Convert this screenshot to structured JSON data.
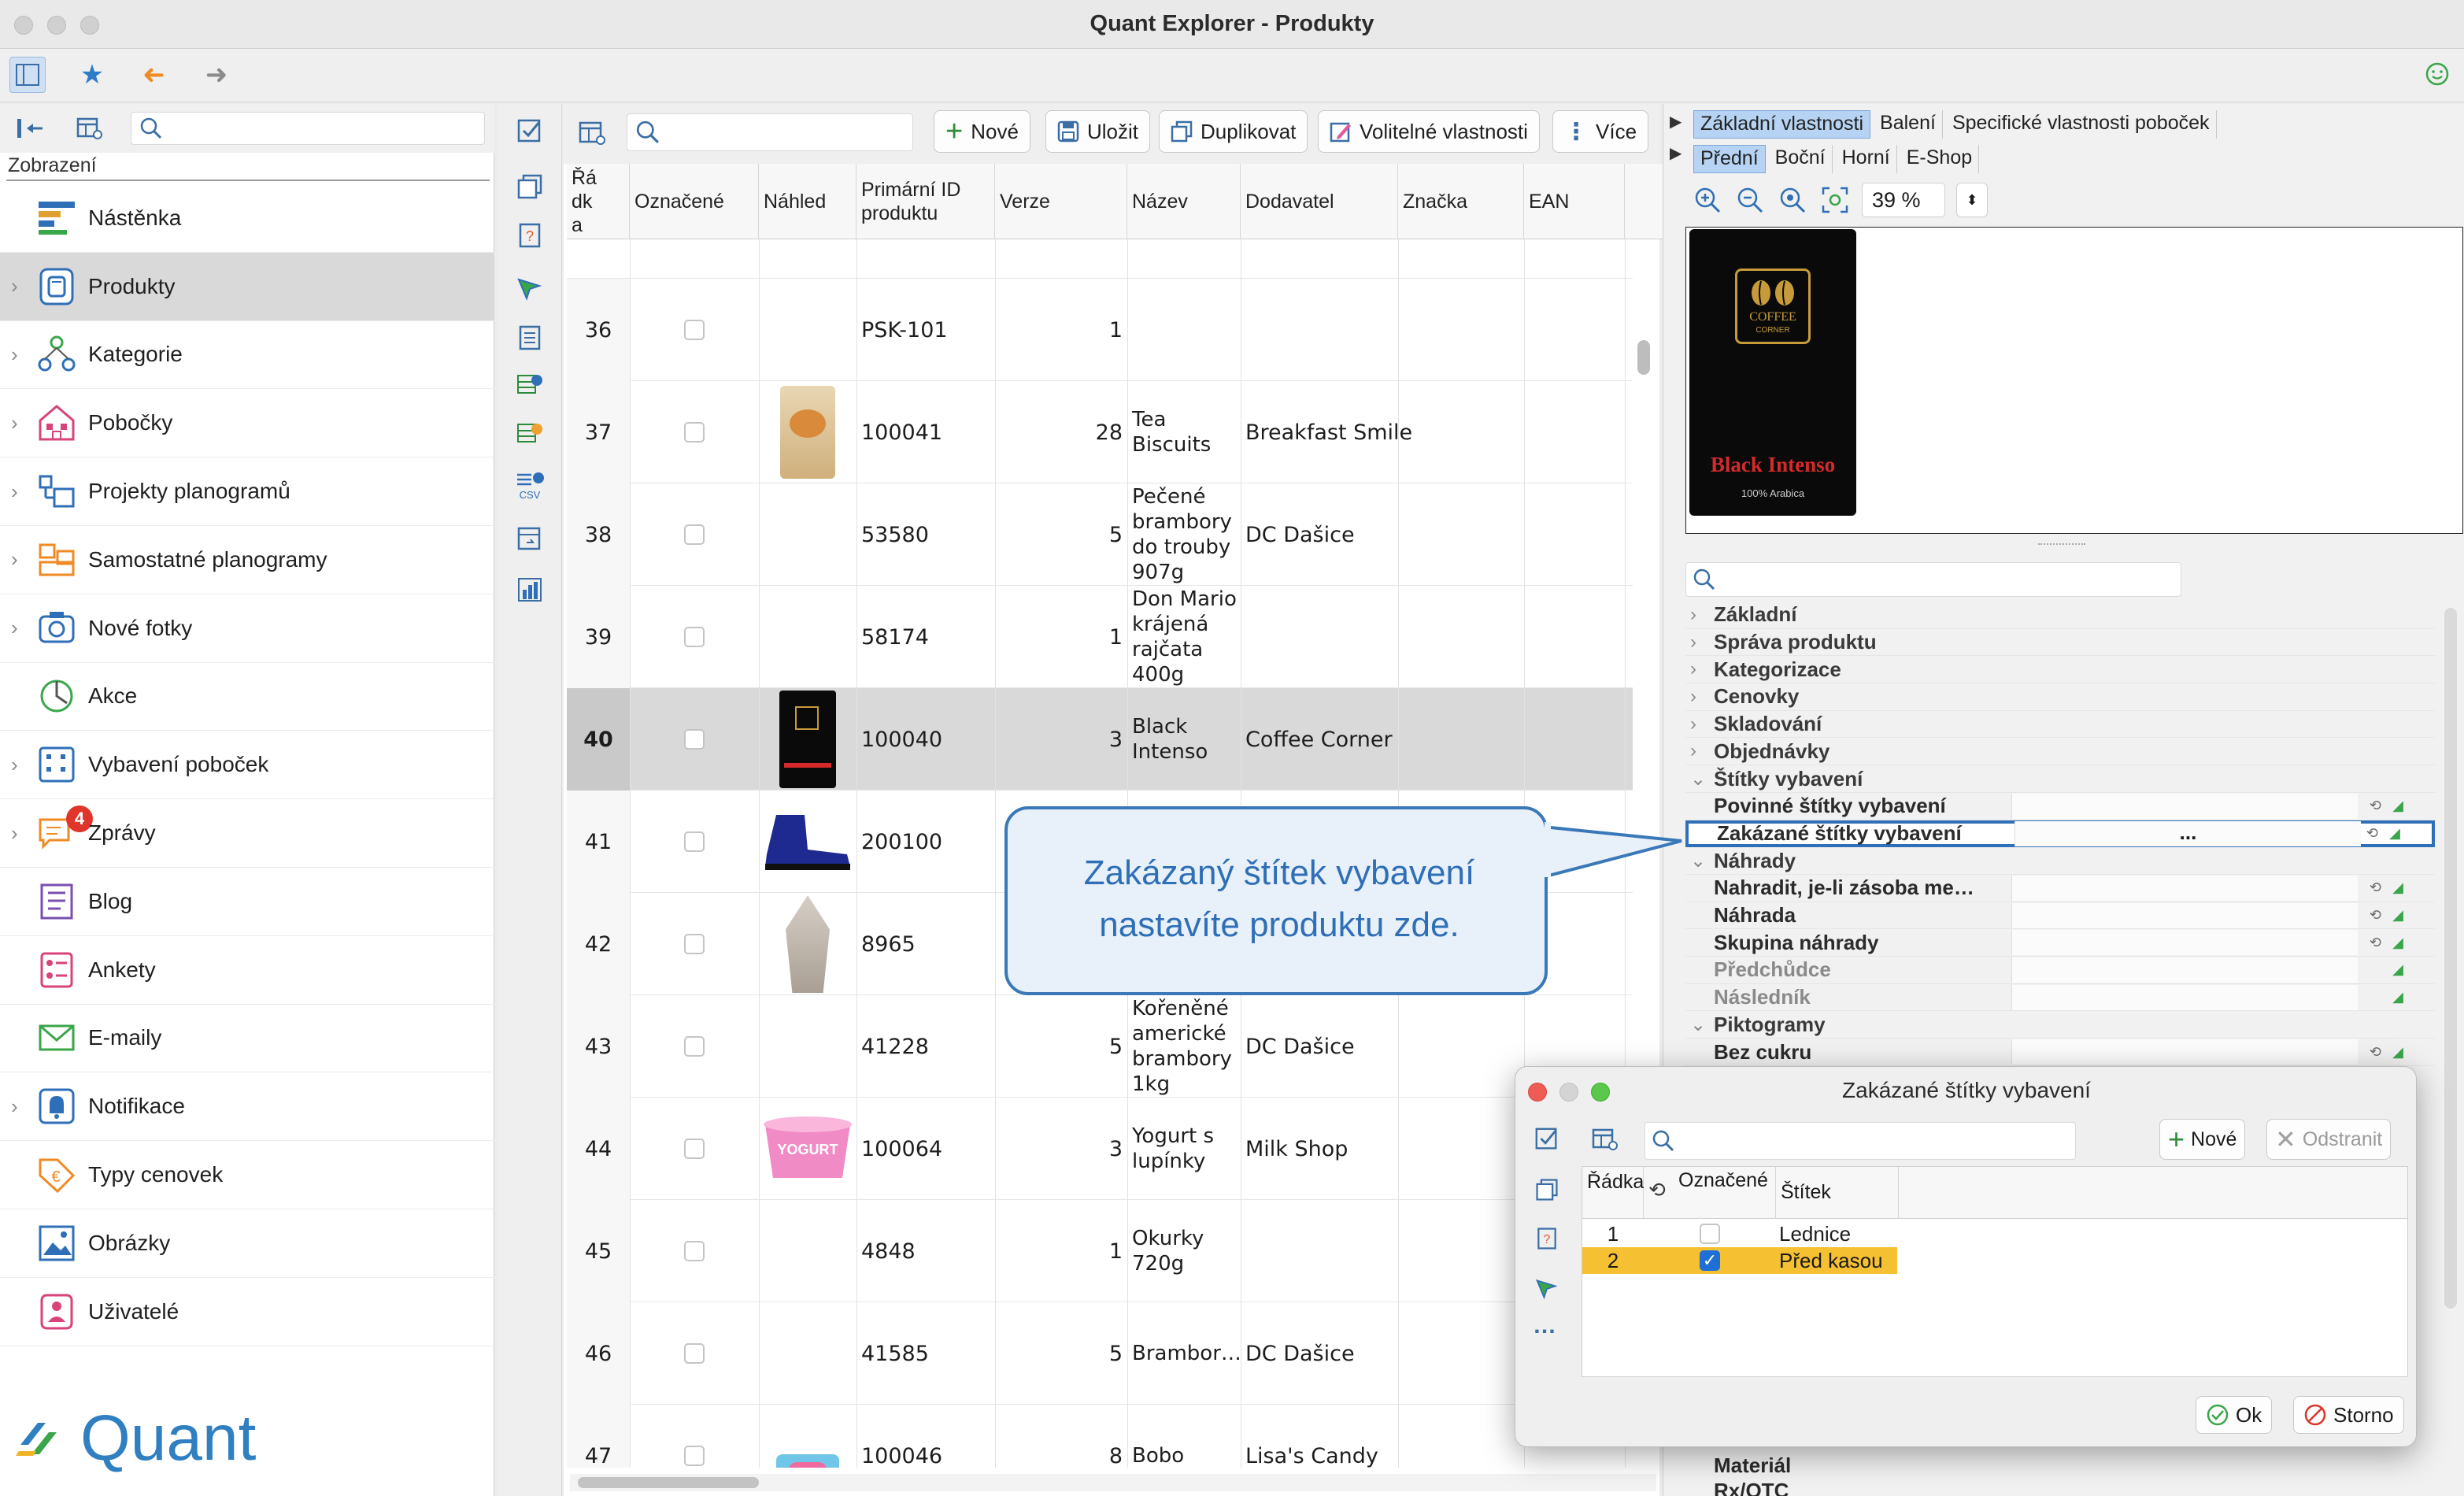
{
  "window": {
    "title": "Quant Explorer - Produkty"
  },
  "sidebar": {
    "heading": "Zobrazení",
    "items": [
      {
        "label": "Nástěnka",
        "icon": "dashboard-icon",
        "chevron": false
      },
      {
        "label": "Produkty",
        "icon": "product-icon",
        "chevron": true,
        "active": true
      },
      {
        "label": "Kategorie",
        "icon": "category-icon",
        "chevron": true
      },
      {
        "label": "Pobočky",
        "icon": "store-icon",
        "chevron": true
      },
      {
        "label": "Projekty planogramů",
        "icon": "planogram-project-icon",
        "chevron": true
      },
      {
        "label": "Samostatné planogramy",
        "icon": "planogram-icon",
        "chevron": true
      },
      {
        "label": "Nové fotky",
        "icon": "camera-icon",
        "chevron": true
      },
      {
        "label": "Akce",
        "icon": "promotion-icon",
        "chevron": false
      },
      {
        "label": "Vybavení poboček",
        "icon": "equipment-icon",
        "chevron": true
      },
      {
        "label": "Zprávy",
        "icon": "messages-icon",
        "chevron": true,
        "badge": "4"
      },
      {
        "label": "Blog",
        "icon": "blog-icon",
        "chevron": false
      },
      {
        "label": "Ankety",
        "icon": "survey-icon",
        "chevron": false
      },
      {
        "label": "E-maily",
        "icon": "email-icon",
        "chevron": false
      },
      {
        "label": "Notifikace",
        "icon": "bell-icon",
        "chevron": true
      },
      {
        "label": "Typy cenovek",
        "icon": "price-tag-icon",
        "chevron": false
      },
      {
        "label": "Obrázky",
        "icon": "image-icon",
        "chevron": false
      },
      {
        "label": "Uživatelé",
        "icon": "user-icon",
        "chevron": false
      }
    ],
    "logo_text": "Quant"
  },
  "center": {
    "buttons": {
      "new": "Nové",
      "save": "Uložit",
      "duplicate": "Duplikovat",
      "optional": "Volitelné vlastnosti",
      "more": "Více"
    },
    "columns": [
      "Řádka",
      "Označené",
      "Náhled",
      "Primární ID produktu",
      "Verze",
      "Název",
      "Dodavatel",
      "Značka",
      "EAN"
    ],
    "rows": [
      {
        "row": "36",
        "id": "PSK-101",
        "version": "1",
        "name": "",
        "supplier": "",
        "thumb": "none"
      },
      {
        "row": "37",
        "id": "100041",
        "version": "28",
        "name": "Tea Biscuits",
        "supplier": "Breakfast Smile",
        "thumb": "biscuits"
      },
      {
        "row": "38",
        "id": "53580",
        "version": "5",
        "name": "Pečené brambory do trouby 907g",
        "supplier": "DC Dašice",
        "thumb": "none"
      },
      {
        "row": "39",
        "id": "58174",
        "version": "1",
        "name": "Don Mario krájená rajčata 400g",
        "supplier": "",
        "thumb": "none"
      },
      {
        "row": "40",
        "id": "100040",
        "version": "3",
        "name": "Black Intenso",
        "supplier": "Coffee Corner",
        "thumb": "coffee",
        "selected": true
      },
      {
        "row": "41",
        "id": "200100",
        "version": "",
        "name": "",
        "supplier": "",
        "thumb": "boot"
      },
      {
        "row": "42",
        "id": "8965",
        "version": "",
        "name": "",
        "supplier": "",
        "thumb": "crystal"
      },
      {
        "row": "43",
        "id": "41228",
        "version": "5",
        "name": "Kořeněné americké brambory 1kg",
        "supplier": "DC Dašice",
        "thumb": "none"
      },
      {
        "row": "44",
        "id": "100064",
        "version": "3",
        "name": "Yogurt s lupínky",
        "supplier": "Milk Shop",
        "thumb": "yogurt"
      },
      {
        "row": "45",
        "id": "4848",
        "version": "1",
        "name": "Okurky 720g",
        "supplier": "",
        "thumb": "none"
      },
      {
        "row": "46",
        "id": "41585",
        "version": "5",
        "name": "Brambor…",
        "supplier": "DC Dašice",
        "thumb": "none"
      },
      {
        "row": "47",
        "id": "100046",
        "version": "8",
        "name": "Bobo",
        "supplier": "Lisa's Candy",
        "thumb": "candy"
      }
    ]
  },
  "right": {
    "tabs_top": [
      "Základní vlastnosti",
      "Balení",
      "Specifické vlastnosti poboček"
    ],
    "tabs_view": [
      "Přední",
      "Boční",
      "Horní",
      "E-Shop"
    ],
    "zoom": "39 %",
    "preview": {
      "brand_top": "COFFEE",
      "brand_sub": "CORNER",
      "product": "Black Intenso",
      "note": "100% Arabica"
    },
    "properties": [
      {
        "label": "Základní",
        "type": "group",
        "open": false
      },
      {
        "label": "Správa produktu",
        "type": "group",
        "open": false
      },
      {
        "label": "Kategorizace",
        "type": "group",
        "open": false
      },
      {
        "label": "Cenovky",
        "type": "group",
        "open": false
      },
      {
        "label": "Skladování",
        "type": "group",
        "open": false
      },
      {
        "label": "Objednávky",
        "type": "group",
        "open": false
      },
      {
        "label": "Štítky vybavení",
        "type": "group",
        "open": true
      },
      {
        "label": "Povinné štítky vybavení",
        "type": "prop"
      },
      {
        "label": "Zakázané štítky vybavení",
        "type": "prop",
        "value": "...",
        "highlight": true
      },
      {
        "label": "Náhrady",
        "type": "group",
        "open": true
      },
      {
        "label": "Nahradit, je-li zásoba me…",
        "type": "prop"
      },
      {
        "label": "Náhrada",
        "type": "prop"
      },
      {
        "label": "Skupina náhrady",
        "type": "prop"
      },
      {
        "label": "Předchůdce",
        "type": "prop",
        "dim": true
      },
      {
        "label": "Následník",
        "type": "prop",
        "dim": true
      },
      {
        "label": "Piktogramy",
        "type": "group",
        "open": true
      },
      {
        "label": "Bez cukru",
        "type": "prop"
      }
    ],
    "bottom_props": [
      "Materiál",
      "Rx/OTC"
    ]
  },
  "callout": {
    "line1": "Zakázaný štítek vybavení",
    "line2": "nastavíte produktu zde."
  },
  "dialog": {
    "title": "Zakázané štítky vybavení",
    "new_label": "Nové",
    "remove_label": "Odstranit",
    "columns": [
      "Řádka",
      "Označené",
      "Štítek"
    ],
    "rows": [
      {
        "row": "1",
        "checked": false,
        "label": "Lednice"
      },
      {
        "row": "2",
        "checked": true,
        "label": "Před kasou",
        "selected": true
      }
    ],
    "ok_label": "Ok",
    "cancel_label": "Storno"
  },
  "colors": {
    "accent": "#2f6fb7",
    "selection": "#f6c033",
    "badge": "#e0352b"
  }
}
